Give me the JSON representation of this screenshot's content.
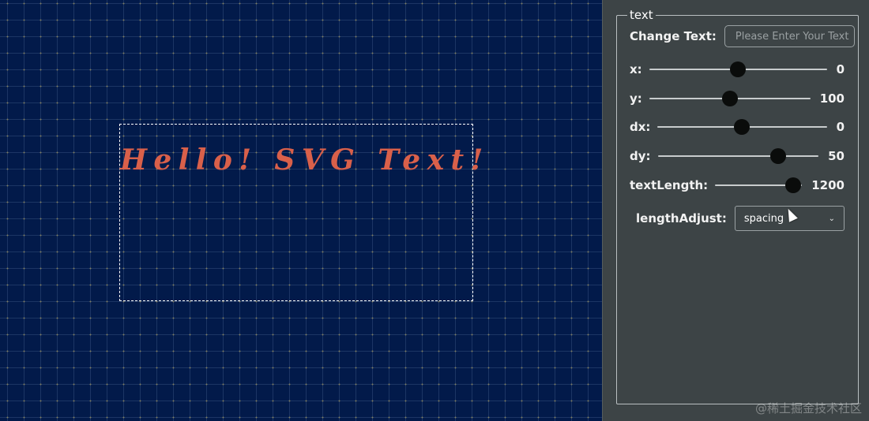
{
  "canvas": {
    "svg_text": "Hello! SVG Text!",
    "text_color": "#d9604a",
    "background_color": "#021a4a"
  },
  "panel": {
    "legend": "text",
    "change_text": {
      "label": "Change Text:",
      "placeholder": "Please Enter Your Text",
      "value": ""
    },
    "sliders": [
      {
        "label": "x:",
        "value": "0",
        "level": 0.5
      },
      {
        "label": "y:",
        "value": "100",
        "level": 0.5
      },
      {
        "label": "dx:",
        "value": "0",
        "level": 0.5
      },
      {
        "label": "dy:",
        "value": "50",
        "level": 0.75
      },
      {
        "label": "textLength:",
        "value": "1200",
        "level": 0.9
      }
    ],
    "length_adjust": {
      "label": "lengthAdjust:",
      "selected": "spacing"
    }
  },
  "watermark": "@稀土掘金技术社区"
}
